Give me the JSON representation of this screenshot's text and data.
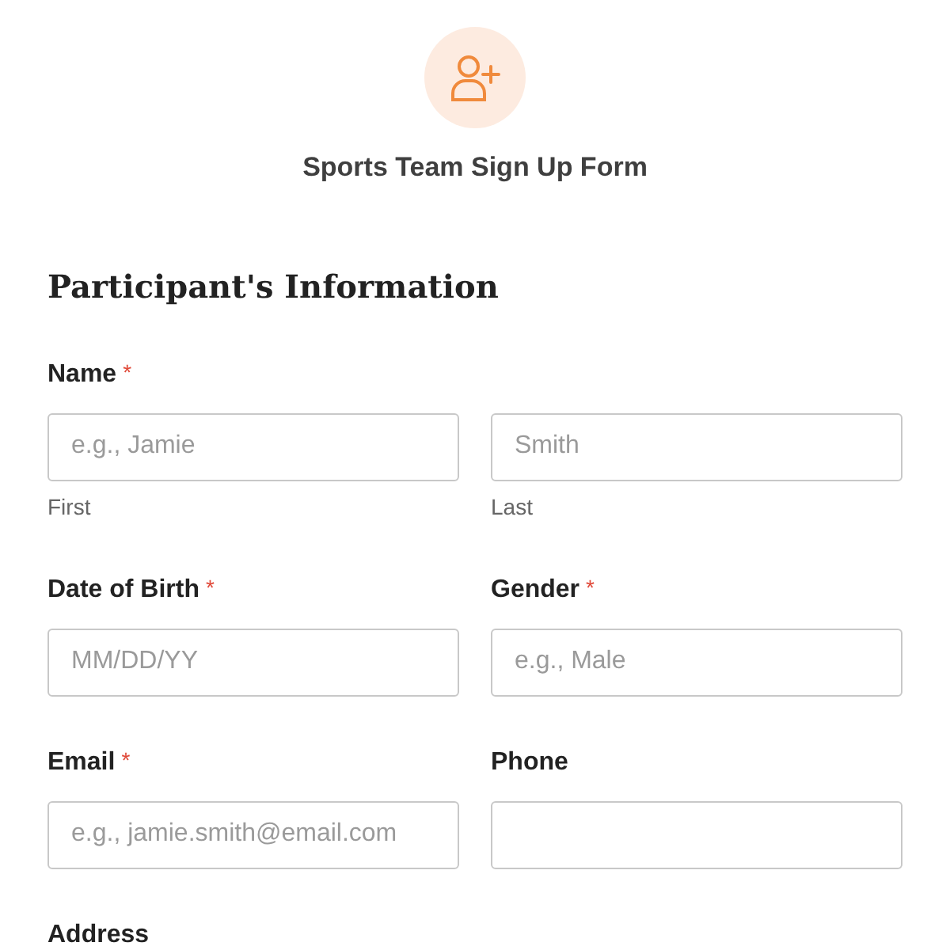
{
  "form": {
    "title": "Sports Team Sign Up Form"
  },
  "section": {
    "heading": "Participant's Information"
  },
  "rows": [
    {
      "fields": [
        {
          "label": "Name",
          "required_mark": "*",
          "inputs": [
            {
              "kind": "text",
              "placeholder": "e.g., Jamie",
              "sublabel": "First"
            },
            {
              "kind": "text",
              "placeholder": "Smith",
              "sublabel": "Last"
            }
          ]
        }
      ]
    },
    {
      "fields": [
        {
          "label": "Date of Birth",
          "required_mark": "*",
          "inputs": [
            {
              "kind": "text",
              "placeholder": "MM/DD/YY"
            }
          ]
        },
        {
          "label": "Gender",
          "required_mark": "*",
          "inputs": [
            {
              "kind": "text",
              "placeholder": "e.g., Male"
            }
          ]
        }
      ]
    },
    {
      "fields": [
        {
          "label": "Email",
          "required_mark": "*",
          "inputs": [
            {
              "kind": "text",
              "placeholder": "e.g., jamie.smith@email.com"
            }
          ]
        },
        {
          "label": "Phone",
          "inputs": [
            {
              "kind": "text"
            }
          ]
        }
      ]
    },
    {
      "fields": [
        {
          "label": "Address"
        }
      ]
    }
  ]
}
